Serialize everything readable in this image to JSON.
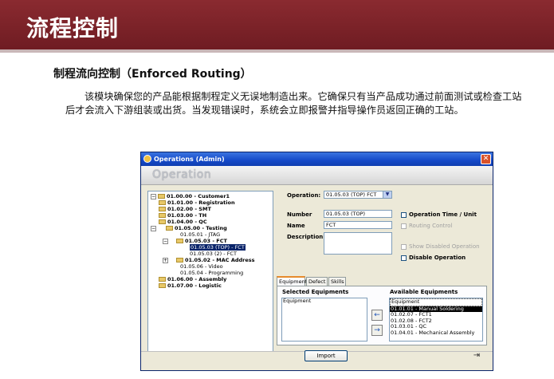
{
  "slide": {
    "title": "流程控制",
    "heading": "制程流向控制（Enforced Routing）",
    "paragraph": "该模块确保您的产品能根据制程定义无误地制造出来。它确保只有当产品成功通过前面测试或检查工站后才会流入下游组装或出货。当发现错误时，系统会立即报警并指导操作员返回正确的工站。"
  },
  "window": {
    "title": "Operations (Admin)",
    "header": "Operation",
    "close_glyph": "✕",
    "tree": [
      {
        "label": "01.00.00 - Customer1",
        "bold": true,
        "folder": true,
        "pm": "−"
      },
      {
        "label": "01.01.00 - Registration",
        "bold": true,
        "folder": true
      },
      {
        "label": "01.02.00 - SMT",
        "bold": true,
        "folder": true
      },
      {
        "label": "01.03.00 - TH",
        "bold": true,
        "folder": true
      },
      {
        "label": "01.04.00 - QC",
        "bold": true,
        "folder": true
      },
      {
        "label": "01.05.00 - Testing",
        "bold": true,
        "folder": true,
        "pm": "−"
      },
      {
        "label": "01.05.01 - JTAG",
        "bold": false,
        "folder": false
      },
      {
        "label": "01.05.03 - FCT",
        "bold": true,
        "folder": true,
        "pm": "−"
      },
      {
        "label": "01.05.03 (TOP) - FCT",
        "bold": false,
        "folder": false,
        "selected": true
      },
      {
        "label": "01.05.03 (2) - FCT",
        "bold": false,
        "folder": false
      },
      {
        "label": "01.05.02 - MAC Address",
        "bold": true,
        "folder": true,
        "pm": "+"
      },
      {
        "label": "01.05.06 - Video",
        "bold": false,
        "folder": false
      },
      {
        "label": "01.05.04 - Programming",
        "bold": false,
        "folder": false
      },
      {
        "label": "01.06.00 - Assembly",
        "bold": true,
        "folder": true
      },
      {
        "label": "01.07.00 - Logistic",
        "bold": true,
        "folder": true
      }
    ],
    "form": {
      "operation_label": "Operation:",
      "operation_value": "01.05.03 (TOP) FCT",
      "number_label": "Number",
      "number_value": "01.05.03 (TOP)",
      "name_label": "Name",
      "name_value": "FCT",
      "description_label": "Description",
      "description_value": ""
    },
    "checkboxes": [
      {
        "label": "Operation Time / Unit",
        "checked": false,
        "enabled": true
      },
      {
        "label": "Routing Control",
        "checked": false,
        "enabled": false
      },
      {
        "label": "Show Disabled Operation",
        "checked": false,
        "enabled": false
      },
      {
        "label": "Disable Operation",
        "checked": false,
        "enabled": true
      }
    ],
    "tabs": [
      "Equipment",
      "Defect",
      "Skills"
    ],
    "active_tab": "Equipment",
    "selected_equipments_label": "Selected Equipments",
    "selected_equipments": [
      "Equipment"
    ],
    "available_equipments_label": "Available Equipments",
    "available_equipments": [
      {
        "label": "Equipment"
      },
      {
        "label": "01.01.01 - Manual Soldering",
        "selected": true
      },
      {
        "label": "01.02.07 - FCT1"
      },
      {
        "label": "01.02.08 - FCT2"
      },
      {
        "label": "01.03.01 - QC"
      },
      {
        "label": "01.04.01 - Mechanical Assembly"
      }
    ],
    "add_arrow": "←",
    "remove_arrow": "→",
    "import_label": "Import",
    "exit_glyph": "⇥"
  },
  "colors": {
    "banner": "#7a2329",
    "titlebar": "#1449c8",
    "tab_accent": "#e68b2c"
  }
}
